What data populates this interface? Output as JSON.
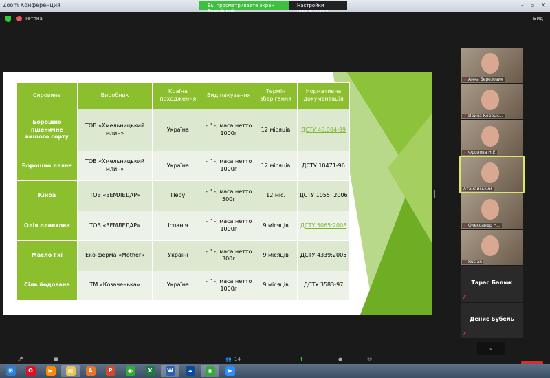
{
  "window": {
    "title": "Zoom Конференция",
    "banner": "Вы просматриваете экран Ромайский",
    "view_options": "Настройки просмотра ▾",
    "controls": [
      "–",
      "▫",
      "✕"
    ]
  },
  "header": {
    "host": "Тетяна",
    "view": "Вид"
  },
  "table": {
    "headers": [
      "Сировина",
      "Виробник",
      "Країна походження",
      "Вид пакування",
      "Термін зберігання",
      "Нормативна документація"
    ],
    "rows": [
      [
        "Борошно пшеничне вищого сорту",
        "ТОВ «Хмельницький млин»",
        "Україна",
        "- “ -, маса нетто 1000г",
        "12 місяців",
        "ДСТУ 46.004-99"
      ],
      [
        "Борошно лляне",
        "ТОВ «Хмельницький млин»",
        "Україна",
        "- “ -, маса нетто 1000г",
        "12 місяців",
        "ДСТУ 10471-96"
      ],
      [
        "Кіноа",
        "ТОВ «ЗЕМЛЕДАР»",
        "Перу",
        "- “ -, маса нетто 500г",
        "12 міс.",
        "ДСТУ 1055: 2006"
      ],
      [
        "Олія оливкова",
        "ТОВ «ЗЕМЛЕДАР»",
        "Іспанія",
        "- “ -, маса нетто 1000г",
        "9 місяців",
        "ДСТУ 5065:2008"
      ],
      [
        "Масло Гхі",
        "Еко-ферма «Mother»",
        "Україні",
        "- “ -, маса нетто 300г",
        "9 місяців",
        "ДСТУ 4339:2005"
      ],
      [
        "Сіль йодована",
        "ТМ «Козаченька»",
        "Україна",
        "- “ -, маса нетто 1000г",
        "9 місяців",
        "ДСТУ 3583-97"
      ]
    ],
    "linked_docs": [
      0,
      3
    ]
  },
  "participants": [
    {
      "name": "Анна Березовик",
      "video": true
    },
    {
      "name": "Ирина Корецк...",
      "video": true
    },
    {
      "name": "Фролова Н.Е",
      "video": true
    },
    {
      "name": "Атамайський",
      "video": true,
      "active": true
    },
    {
      "name": "Олександр Н...",
      "video": true
    },
    {
      "name": "Ruslan",
      "video": true
    },
    {
      "name": "Тарас Балюк",
      "video": false
    },
    {
      "name": "Денис Бубель",
      "video": false
    }
  ],
  "toolbar": {
    "participants_count": "14",
    "expand": "⌄"
  },
  "taskbar": [
    {
      "icon": "windows-start-icon",
      "label": "⊞",
      "color": "#2a7fd4"
    },
    {
      "icon": "opera-icon",
      "label": "O",
      "color": "#d12"
    },
    {
      "icon": "media-player-icon",
      "label": "▶",
      "color": "#f80"
    },
    {
      "icon": "explorer-icon",
      "label": "▤",
      "color": "#e9c45a"
    },
    {
      "icon": "app-icon",
      "label": "A",
      "color": "#e8742a"
    },
    {
      "icon": "powerpoint-icon",
      "label": "P",
      "color": "#d04a2a"
    },
    {
      "icon": "chrome-icon",
      "label": "◉",
      "color": "#3a3"
    },
    {
      "icon": "excel-icon",
      "label": "X",
      "color": "#1e7a3a"
    },
    {
      "icon": "word-icon",
      "label": "W",
      "color": "#2b5fb4"
    },
    {
      "icon": "onedrive-icon",
      "label": "☁",
      "color": "#0a4a9a"
    },
    {
      "icon": "chrome-icon",
      "label": "◉",
      "color": "#3a3"
    },
    {
      "icon": "zoom-icon",
      "label": "▶",
      "color": "#2d8cff"
    }
  ],
  "colors": {
    "accent": "#8cbf2e",
    "banner": "#3fbf3f"
  }
}
